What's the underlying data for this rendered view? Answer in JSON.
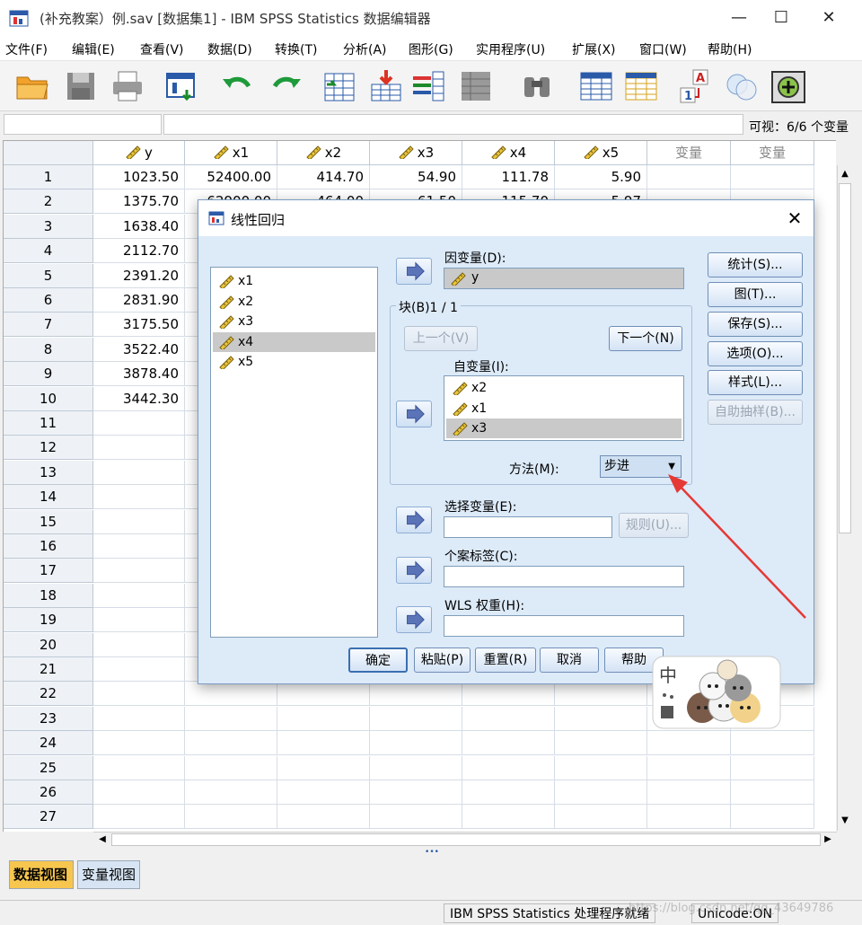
{
  "window": {
    "title": "(补充教案）例.sav [数据集1] - IBM SPSS Statistics 数据编辑器",
    "minimize": "—",
    "maximize": "☐",
    "close": "✕"
  },
  "menu": [
    "文件(F)",
    "编辑(E)",
    "查看(V)",
    "数据(D)",
    "转换(T)",
    "分析(A)",
    "图形(G)",
    "实用程序(U)",
    "扩展(X)",
    "窗口(W)",
    "帮助(H)"
  ],
  "toolbar_icons": [
    "open-folder-icon",
    "save-disk-icon",
    "print-icon",
    "recall-dialog-icon",
    "undo-icon",
    "redo-icon",
    "goto-case-icon",
    "goto-variable-icon",
    "variables-icon",
    "run-descriptives-icon",
    "find-icon",
    "insert-cases-icon",
    "insert-variable-icon",
    "split-file-icon",
    "weight-cases-icon",
    "select-cases-icon",
    "value-labels-icon",
    "use-sets-icon"
  ],
  "visible_vars": "可视：6/6 个变量",
  "grid": {
    "columns": [
      "y",
      "x1",
      "x2",
      "x3",
      "x4",
      "x5",
      "变量",
      "变量"
    ],
    "rows": [
      [
        "1023.50",
        "52400.00",
        "414.70",
        "54.90",
        "111.78",
        "5.90"
      ],
      [
        "1375.70",
        "62900.00",
        "464.00",
        "61.50",
        "115.70",
        "5.97"
      ],
      [
        "1638.40",
        "",
        "",
        "",
        "",
        ""
      ],
      [
        "2112.70",
        "",
        "",
        "",
        "",
        ""
      ],
      [
        "2391.20",
        "",
        "",
        "",
        "",
        ""
      ],
      [
        "2831.90",
        "",
        "",
        "",
        "",
        ""
      ],
      [
        "3175.50",
        "",
        "",
        "",
        "",
        ""
      ],
      [
        "3522.40",
        "",
        "",
        "",
        "",
        ""
      ],
      [
        "3878.40",
        "",
        "",
        "",
        "",
        ""
      ],
      [
        "3442.30",
        "",
        "",
        "",
        "",
        ""
      ]
    ],
    "row_numbers": [
      "1",
      "2",
      "3",
      "4",
      "5",
      "6",
      "7",
      "8",
      "9",
      "10",
      "11",
      "12",
      "13",
      "14",
      "15",
      "16",
      "17",
      "18",
      "19",
      "20",
      "21",
      "22",
      "23",
      "24",
      "25",
      "26",
      "27"
    ]
  },
  "tabs": {
    "data_view": "数据视图",
    "variable_view": "变量视图"
  },
  "status": {
    "processor": "IBM SPSS Statistics 处理程序就绪",
    "unicode": "Unicode:ON"
  },
  "dialog": {
    "title": "线性回归",
    "source_vars": [
      {
        "name": "x1",
        "selected": false
      },
      {
        "name": "x2",
        "selected": false
      },
      {
        "name": "x3",
        "selected": false
      },
      {
        "name": "x4",
        "selected": true
      },
      {
        "name": "x5",
        "selected": false
      }
    ],
    "dependent_label": "因变量(D):",
    "dependent_value": "y",
    "block_label": "块(B)1 / 1",
    "prev_button": "上一个(V)",
    "next_button": "下一个(N)",
    "independent_label": "自变量(I):",
    "independent_vars": [
      {
        "name": "x2",
        "selected": false
      },
      {
        "name": "x1",
        "selected": false
      },
      {
        "name": "x3",
        "selected": true
      }
    ],
    "method_label": "方法(M):",
    "method_value": "步进",
    "selection_label": "选择变量(E):",
    "rule_button": "规则(U)...",
    "case_label": "个案标签(C):",
    "wls_label": "WLS 权重(H):",
    "side_buttons": [
      "统计(S)...",
      "图(T)...",
      "保存(S)...",
      "选项(O)...",
      "样式(L)...",
      "自助抽样(B)..."
    ],
    "bottom_buttons": [
      "确定",
      "粘贴(P)",
      "重置(R)",
      "取消",
      "帮助"
    ]
  },
  "sticker_text": "中",
  "watermark": "https://blog.csdn.net/qq_43649786",
  "colors": {
    "dialog_bg": "#ddeaf8",
    "data_tab": "#f6c64e",
    "arrow_red": "#e53935",
    "ruler_yellow": "#e8c33c"
  }
}
